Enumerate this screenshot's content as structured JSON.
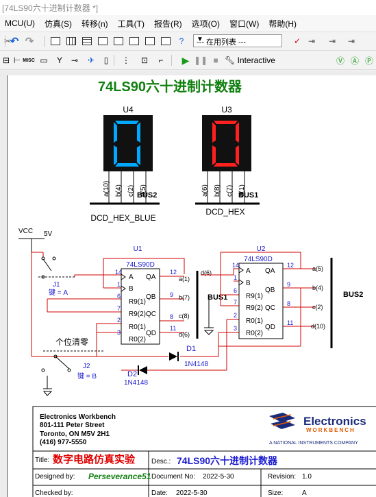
{
  "window": {
    "title": "[74LS90六十进制计数器 *]"
  },
  "menu": [
    "MCU(U)",
    "仿真(S)",
    "转移(n)",
    "工具(T)",
    "报告(R)",
    "选项(O)",
    "窗口(W)",
    "帮助(H)"
  ],
  "toolbar": {
    "inuse_list": "--- 在用列表 ---",
    "interactive_label": "Interactive",
    "misc_label": "MISC",
    "sheet_icons": [
      "undo-icon",
      "redo-icon",
      "grid-icon",
      "table-icon",
      "component-icon",
      "bars-icon",
      "wave-icon",
      "chart-icon",
      "spreadsheet-icon",
      "clipboard-icon"
    ]
  },
  "schematic": {
    "title": "74LS90六十进制计数器",
    "displays": [
      {
        "ref": "U4",
        "digit": "0",
        "color": "#00a8ff",
        "model": "DCD_HEX_BLUE",
        "bus": "BUS2",
        "pins": [
          "a(10)",
          "b(4)",
          "c(2)",
          "d(5)"
        ]
      },
      {
        "ref": "U3",
        "digit": "0",
        "color": "#ff2020",
        "model": "DCD_HEX",
        "bus": "BUS1",
        "pins": [
          "a(6)",
          "b(8)",
          "c(7)",
          "d(1)"
        ]
      }
    ],
    "power": {
      "name": "VCC",
      "value": "5V"
    },
    "chips": [
      {
        "ref": "U1",
        "model": "74LS90D",
        "left_pins": [
          {
            "num": "14",
            "name": "A"
          },
          {
            "num": "1",
            "name": "B"
          },
          {
            "num": "6",
            "name": "R9(1)"
          },
          {
            "num": "7",
            "name": "R9(2)"
          },
          {
            "num": "2",
            "name": "R0(1)"
          },
          {
            "num": "3",
            "name": "R0(2)"
          }
        ],
        "right_pins": [
          {
            "num": "12",
            "name": "QA"
          },
          {
            "num": "9",
            "name": "QB"
          },
          {
            "num": "8",
            "name": "QC"
          },
          {
            "num": "11",
            "name": "QD"
          }
        ],
        "net_labels": [
          "a(1)",
          "b(7)",
          "c(8)",
          "d(6)"
        ]
      },
      {
        "ref": "U2",
        "model": "74LS90D",
        "left_pins": [
          {
            "num": "14",
            "name": "A"
          },
          {
            "num": "1",
            "name": "B"
          },
          {
            "num": "6",
            "name": "R9(1)"
          },
          {
            "num": "7",
            "name": "R9(2)"
          },
          {
            "num": "2",
            "name": "R0(1)"
          },
          {
            "num": "3",
            "name": "R0(2)"
          }
        ],
        "right_pins": [
          {
            "num": "12",
            "name": "QA"
          },
          {
            "num": "9",
            "name": "QB"
          },
          {
            "num": "8",
            "name": "QC"
          },
          {
            "num": "11",
            "name": "QD"
          }
        ],
        "net_labels": [
          "a(5)",
          "b(4)",
          "c(2)",
          "d(10)"
        ]
      }
    ],
    "bus_labels": {
      "bus1": "BUS1",
      "bus2": "BUS2",
      "u1_in": "d(6)"
    },
    "switches": [
      {
        "ref": "J1",
        "label": "键 = A"
      },
      {
        "ref": "J2",
        "label": "键 = B"
      }
    ],
    "reset_label": "个位清零",
    "diodes": [
      {
        "ref": "D1",
        "model": "1N4148"
      },
      {
        "ref": "D2",
        "model": "1N4148"
      }
    ],
    "titleblock": {
      "company": "Electronics Workbench",
      "address1": "801-111 Peter Street",
      "address2": "Toronto, ON M5V 2H1",
      "phone": "(416) 977-5550",
      "logo_word1": "Electronics",
      "logo_word2": "WORKBENCH",
      "logo_tagline": "A NATIONAL INSTRUMENTS COMPANY",
      "title_label": "Title:",
      "title_value": "数字电路仿真实验",
      "desc_label": "Desc.:",
      "desc_value": "74LS90六十进制计数器",
      "designed_label": "Designed by:",
      "designed_value": "Perseverance51",
      "docno_label": "Document No:",
      "docno_value": "2022-5-30",
      "revision_label": "Revision:",
      "revision_value": "1.0",
      "checked_label": "Checked by:",
      "date_label": "Date:",
      "date_value": "2022-5-30",
      "size_label": "Size:",
      "size_value": "A"
    }
  }
}
